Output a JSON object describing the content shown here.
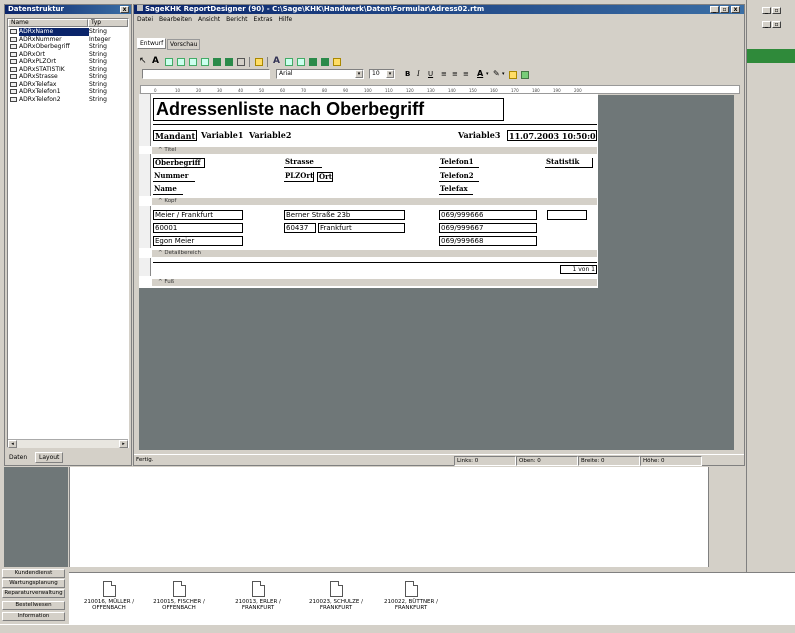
{
  "datastruct": {
    "title": "Datenstruktur",
    "col_name": "Name",
    "col_type": "Typ",
    "rows": [
      {
        "name": "ADRxName",
        "type": "String"
      },
      {
        "name": "ADRxNummer",
        "type": "Integer"
      },
      {
        "name": "ADRxOberbegriff",
        "type": "String"
      },
      {
        "name": "ADRxOrt",
        "type": "String"
      },
      {
        "name": "ADRxPLZOrt",
        "type": "String"
      },
      {
        "name": "ADRxSTATISTIK",
        "type": "String"
      },
      {
        "name": "ADRxStrasse",
        "type": "String"
      },
      {
        "name": "ADRxTelefax",
        "type": "String"
      },
      {
        "name": "ADRxTelefon1",
        "type": "String"
      },
      {
        "name": "ADRxTelefon2",
        "type": "String"
      }
    ],
    "tab_data": "Daten",
    "tab_layout": "Layout"
  },
  "designer": {
    "title": "SageKHK ReportDesigner (90) - C:\\Sage\\KHK\\Handwerk\\Daten\\Formular\\Adress02.rtm",
    "menu": [
      "Datei",
      "Bearbeiten",
      "Ansicht",
      "Bericht",
      "Extras",
      "Hilfe"
    ],
    "tab_design": "Entwurf",
    "tab_preview": "Vorschau",
    "font_name": "Arial",
    "font_size": "10",
    "ruler_marks": [
      "0",
      "10",
      "20",
      "30",
      "40",
      "50",
      "60",
      "70",
      "80",
      "90",
      "100",
      "110",
      "120",
      "130",
      "140",
      "150",
      "160",
      "170",
      "180",
      "190",
      "200"
    ],
    "status_ready": "Fertig.",
    "status_left": "Links: 0",
    "status_top": "Oben: 0",
    "status_width": "Breite: 0",
    "status_height": "Höhe: 0"
  },
  "report": {
    "heading": "Adressenliste nach Oberbegriff",
    "mandant_label": "Mandant:",
    "var1": "Variable1",
    "var2": "Variable2",
    "var3": "Variable3",
    "datetime": "11.07.2003 10:50:01",
    "band_title": "Titel",
    "h_oberbegriff": "Oberbegriff",
    "h_nummer": "Nummer",
    "h_name": "Name",
    "h_strasse": "Strasse",
    "h_plzort": "PLZOrt",
    "h_ort": "Ort",
    "h_tel1": "Telefon1",
    "h_tel2": "Telefon2",
    "h_telefax": "Telefax",
    "h_statistik": "Statistik",
    "band_head": "Kopf",
    "d_oberbegriff": "Meier / Frankfurt",
    "d_nummer": "60001",
    "d_name": "Egon Meier",
    "d_strasse": "Berner Straße 23b",
    "d_plz": "60437",
    "d_ort": "Frankfurt",
    "d_tel1": "069/999666",
    "d_tel2": "069/999667",
    "d_fax": "069/999668",
    "band_detail": "Detailbereich",
    "page_of": "1 von 1",
    "band_foot": "Fuß"
  },
  "nav": {
    "items": [
      "Kundendienst",
      "Wartungsplanung",
      "Reparaturverwaltung",
      "Bestellwesen",
      "Information"
    ]
  },
  "docs": [
    {
      "line1": "210016, MÜLLER /",
      "line2": "OFFENBACH"
    },
    {
      "line1": "210015, FISCHER /",
      "line2": "OFFENBACH"
    },
    {
      "line1": "210013, ERLER /",
      "line2": "FRANKFURT"
    },
    {
      "line1": "210023, SCHULZE /",
      "line2": "FRANKFURT"
    },
    {
      "line1": "210022, BÜTTNER /",
      "line2": "FRANKFURT"
    }
  ],
  "colors": {
    "titlebar": "#0a246a",
    "canvas": "#6f7778",
    "page": "#ffffff"
  }
}
